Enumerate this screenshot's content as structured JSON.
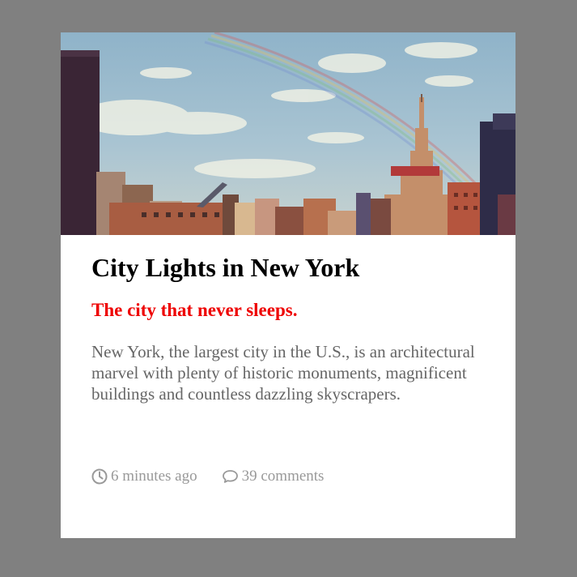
{
  "card": {
    "title": "City Lights in New York",
    "subtitle": "The city that never sleeps.",
    "description": "New York, the largest city in the U.S., is an architectural marvel with plenty of historic monuments, magnificent buildings and countless dazzling skyscrapers.",
    "meta": {
      "time_icon": "clock-icon",
      "time": "6 minutes ago",
      "comments_icon": "comment-icon",
      "comments": "39 comments"
    }
  },
  "colors": {
    "page_background": "#808080",
    "card_background": "#ffffff",
    "title": "#000000",
    "subtitle": "#ee0000",
    "body_text": "#666666",
    "meta_text": "#999999"
  }
}
